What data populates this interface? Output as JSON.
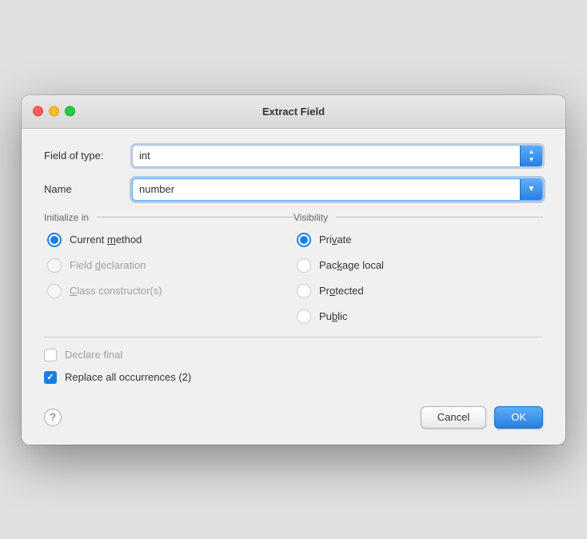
{
  "dialog": {
    "title": "Extract Field",
    "traffic_lights": {
      "close": "close",
      "minimize": "minimize",
      "maximize": "maximize"
    }
  },
  "field_of_type": {
    "label": "Field of type:",
    "value": "int"
  },
  "name": {
    "label": "Name",
    "value": "number"
  },
  "initialize_in": {
    "label": "Initialize in",
    "options": [
      {
        "id": "current_method",
        "label": "Current method",
        "underline": "m",
        "checked": true,
        "disabled": false
      },
      {
        "id": "field_declaration",
        "label": "Field declaration",
        "underline": "d",
        "checked": false,
        "disabled": true
      },
      {
        "id": "class_constructor",
        "label": "Class constructor(s)",
        "underline": "c",
        "checked": false,
        "disabled": true
      }
    ]
  },
  "visibility": {
    "label": "Visibility",
    "options": [
      {
        "id": "private",
        "label": "Private",
        "underline": "v",
        "checked": true,
        "disabled": false
      },
      {
        "id": "package_local",
        "label": "Package local",
        "underline": "k",
        "checked": false,
        "disabled": false
      },
      {
        "id": "protected",
        "label": "Protected",
        "underline": "o",
        "checked": false,
        "disabled": false
      },
      {
        "id": "public",
        "label": "Public",
        "underline": "b",
        "checked": false,
        "disabled": false
      }
    ]
  },
  "declare_final": {
    "label": "Declare final",
    "checked": false,
    "disabled": true
  },
  "replace_all": {
    "label": "Replace all occurrences (2)",
    "checked": true,
    "disabled": false
  },
  "buttons": {
    "help": "?",
    "cancel": "Cancel",
    "ok": "OK"
  }
}
